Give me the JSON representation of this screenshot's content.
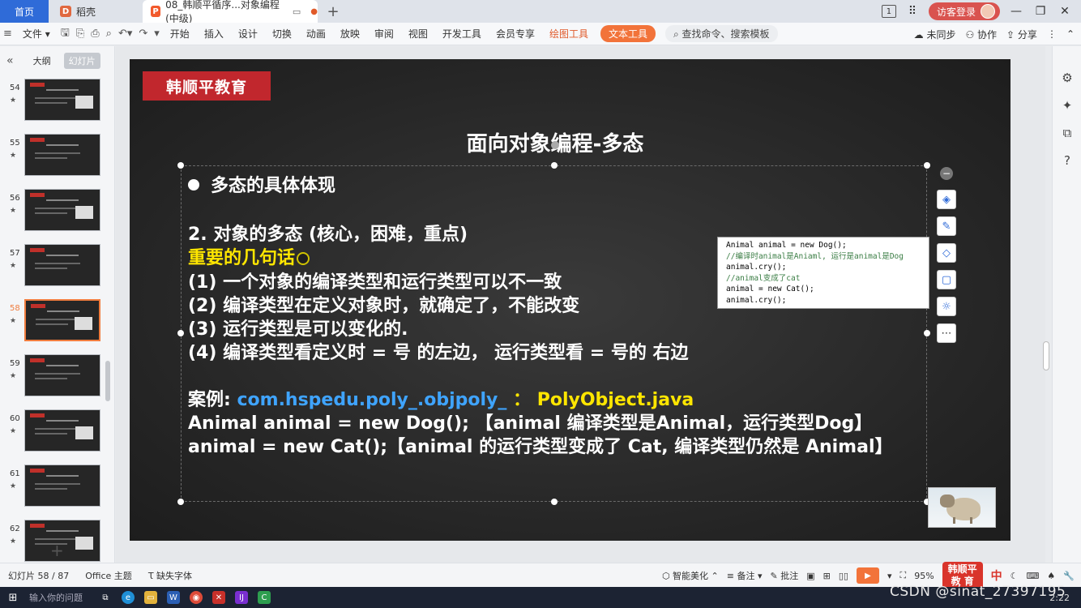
{
  "tabs": {
    "home": "首页",
    "docer": "稻壳",
    "active_doc": "08_韩顺平循序...对象编程(中级)",
    "add": "+"
  },
  "window": {
    "badge": "1",
    "login": "访客登录"
  },
  "ribbon": {
    "file": "文件",
    "menus": [
      "开始",
      "插入",
      "设计",
      "切换",
      "动画",
      "放映",
      "审阅",
      "视图",
      "开发工具",
      "会员专享"
    ],
    "draw_tool": "绘图工具",
    "text_tool": "文本工具",
    "search": "查找命令、搜索模板",
    "sync": "未同步",
    "collab": "协作",
    "share": "分享"
  },
  "left_panel": {
    "tab_outline": "大纲",
    "tab_slides": "幻灯片",
    "thumbnails": [
      {
        "num": "54",
        "star": "★"
      },
      {
        "num": "55",
        "star": "★"
      },
      {
        "num": "56",
        "star": "★"
      },
      {
        "num": "57",
        "star": "★"
      },
      {
        "num": "58",
        "star": "★",
        "active": true
      },
      {
        "num": "59",
        "star": "★"
      },
      {
        "num": "60",
        "star": "★"
      },
      {
        "num": "61",
        "star": "★"
      },
      {
        "num": "62",
        "star": "★"
      }
    ],
    "add": "+"
  },
  "slide": {
    "brand": "韩顺平教育",
    "title": "面向对象编程-多态",
    "heading": "多态的具体体现",
    "sub": "2. 对象的多态 (核心，困难，重点)",
    "important": "重要的几句话",
    "points": [
      "(1) 一个对象的编译类型和运行类型可以不一致",
      "(2) 编译类型在定义对象时，就确定了，不能改变",
      "(3) 运行类型是可以变化的.",
      "(4) 编译类型看定义时 = 号 的左边， 运行类型看 = 号的 右边"
    ],
    "case_label": "案例:",
    "case_pkg": "com.hspedu.poly_.objpoly_",
    "case_sep": "：",
    "case_file": "PolyObject.java",
    "line1": "Animal animal = new Dog(); 【animal 编译类型是Animal，运行类型Dog】",
    "line2": "animal = new Cat();【animal 的运行类型变成了 Cat, 编译类型仍然是 Animal】",
    "code": [
      "Animal animal = new Dog();",
      "//编译时animal是Aniaml, 运行是animal是Dog",
      "animal.cry();",
      "//animal变成了cat",
      "animal = new Cat();",
      "animal.cry();"
    ]
  },
  "status": {
    "slide_info": "幻灯片 58 / 87",
    "theme": "Office 主题",
    "missing_font": "缺失字体",
    "beautify": "智能美化",
    "notes": "备注",
    "comments": "批注",
    "zoom": "95%",
    "logo_line1": "韩顺平",
    "logo_line2": "教 育",
    "ime": "中"
  },
  "taskbar": {
    "search": "输入你的问题",
    "time": "2:22"
  },
  "watermark": "CSDN @sinat_27397195"
}
